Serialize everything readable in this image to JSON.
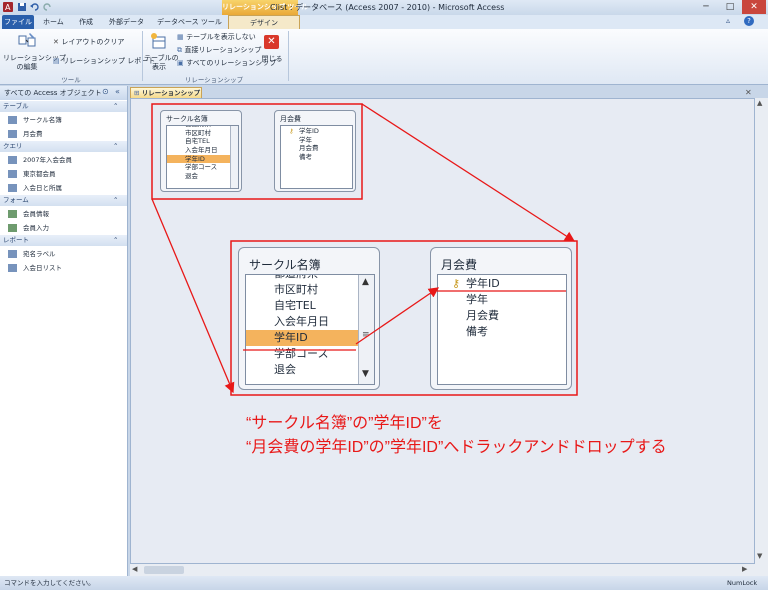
{
  "window": {
    "title": "Clist : データベース (Access 2007 - 2010) - Microsoft Access",
    "context_tab_label": "リレーションシップ ツール",
    "min": "─",
    "max": "□",
    "close": "✕"
  },
  "ribbon_tabs": {
    "file": "ファイル",
    "home": "ホーム",
    "create": "作成",
    "external": "外部データ",
    "dbtools": "データベース ツール",
    "design": "デザイン"
  },
  "ribbon": {
    "tools_group": {
      "edit_relationships": "リレーションシップ\nの編集",
      "edit_line1": "リレーションシップ",
      "edit_line2": "の編集",
      "clear_layout": "レイアウトのクリア",
      "relationship_report": "リレーションシップ レポート",
      "label": "ツール"
    },
    "relationships_group": {
      "show_table_line1": "テーブルの",
      "show_table_line2": "表示",
      "hide_table": "テーブルを表示しない",
      "direct_relationships": "直接リレーションシップ",
      "all_relationships": "すべてのリレーションシップ",
      "close_line1": "閉じる",
      "label": "リレーションシップ"
    }
  },
  "nav": {
    "header": "すべての Access オブジェクト",
    "categories": [
      {
        "label": "テーブル",
        "items": [
          "サークル名簿",
          "月会費"
        ]
      },
      {
        "label": "クエリ",
        "items": [
          "2007年入会会員",
          "東京都会員",
          "入会日と所属"
        ]
      },
      {
        "label": "フォーム",
        "items": [
          "会員情報",
          "会員入力"
        ]
      },
      {
        "label": "レポート",
        "items": [
          "宛名ラベル",
          "入会日リスト"
        ]
      }
    ]
  },
  "doc_tab": "リレーションシップ",
  "small_tables": {
    "circle": {
      "title": "サークル名簿",
      "fields": [
        "都道府県",
        "市区町村",
        "自宅TEL",
        "入会年月日",
        "学年ID",
        "学部コース",
        "退会"
      ]
    },
    "fee": {
      "title": "月会費",
      "fields": [
        "学年ID",
        "学年",
        "月会費",
        "備考"
      ]
    }
  },
  "zoom_tables": {
    "circle": {
      "title": "サークル名簿",
      "fields": [
        "都道府県",
        "市区町村",
        "自宅TEL",
        "入会年月日",
        "学年ID",
        "学部コース",
        "退会"
      ]
    },
    "fee": {
      "title": "月会費",
      "fields": [
        "学年ID",
        "学年",
        "月会費",
        "備考"
      ]
    }
  },
  "caption": {
    "line1": "“サークル名簿”の”学年ID”を",
    "line2": "“月会費の学年ID”の”学年ID”へドラックアンドドロップする"
  },
  "status": {
    "left": "コマンドを入力してください。",
    "right": "NumLock"
  },
  "colors": {
    "accent_red": "#e81818",
    "selection": "#f4b35d",
    "file_tab": "#2a5fab"
  }
}
